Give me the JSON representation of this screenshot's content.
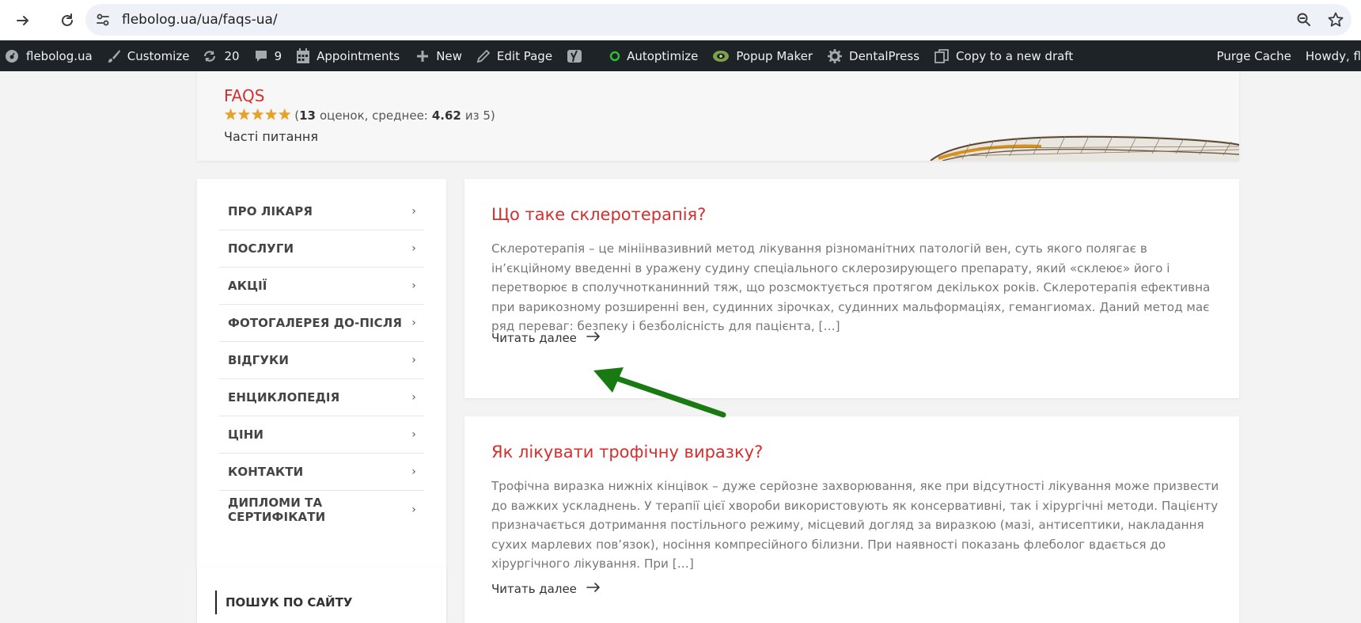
{
  "browser": {
    "url": "flebolog.ua/ua/faqs-ua/",
    "icons": [
      "forward-icon",
      "reload-icon",
      "site-settings-icon",
      "zoom-icon",
      "bookmark-star-icon"
    ]
  },
  "admin_bar": {
    "site": "flebolog.ua",
    "customize": "Customize",
    "updates": "20",
    "comments": "9",
    "appointments": "Appointments",
    "new": "New",
    "edit_page": "Edit Page",
    "autoptimize": "Autoptimize",
    "popup_maker": "Popup Maker",
    "dentalpress": "DentalPress",
    "copy_draft": "Copy to a new draft",
    "purge_cache": "Purge Cache",
    "howdy": "Howdy, fl"
  },
  "header": {
    "title": "FAQS",
    "rating_count": "13",
    "rating_text_1": "оценок, среднее:",
    "rating_avg": "4.62",
    "rating_text_2": "из 5)",
    "rating_open": "(",
    "stars": 4.62,
    "tagline": "Часті питання"
  },
  "sidebar": {
    "menu": [
      {
        "label": "ПРО ЛІКАРЯ"
      },
      {
        "label": "ПОСЛУГИ"
      },
      {
        "label": "АКЦІЇ"
      },
      {
        "label": "ФОТОГАЛЕРЕЯ ДО-ПІСЛЯ"
      },
      {
        "label": "ВІДГУКИ"
      },
      {
        "label": "ЕНЦИКЛОПЕДІЯ"
      },
      {
        "label": "ЦІНИ"
      },
      {
        "label": "КОНТАКТИ"
      },
      {
        "label": "ДИПЛОМИ ТА СЕРТИФІКАТИ"
      }
    ],
    "search_title": "ПОШУК ПО САЙТУ"
  },
  "posts": [
    {
      "title": "Що таке склеротерапія?",
      "excerpt": "Склеротерапія – це мініінвазивний метод лікування різноманітних патологій вен, суть якого полягає в ін’єкційному введенні в уражену судину спеціального склерозирующего препарату, який «склеює» його і перетворює в сполучнотканинний тяж, що розсмоктується протягом декількох років. Склеротерапія ефективна при варикозному розширенні вен, судинних зірочках, судинних мальформаціях, гемангиомах. Даний метод має ряд переваг: безпеку і безболісність для пацієнта, […]",
      "read_more": "Читать далее"
    },
    {
      "title": "Як лікувати трофічну виразку?",
      "excerpt": "Трофічна виразка нижніх кінцівок – дуже серйозне захворювання, яке при відсутності лікування може призвести до важких ускладнень. У терапії цієї хвороби використовують як консервативні, так і хірургічні методи. Пацієнту призначається дотримання постільного режиму, місцевий догляд за виразкою (мазі, антисептики, накладання сухих марлевих пов’язок), носіння компресійного білизни. При наявності показань флеболог вдається до хірургічного лікування. При […]",
      "read_more": "Читать далее"
    }
  ],
  "colors": {
    "accent": "#d22f2f",
    "admin_bar": "#1d2327",
    "annotation_arrow": "#1a7a12",
    "autoptimize_dot": "#2fbf2f"
  }
}
